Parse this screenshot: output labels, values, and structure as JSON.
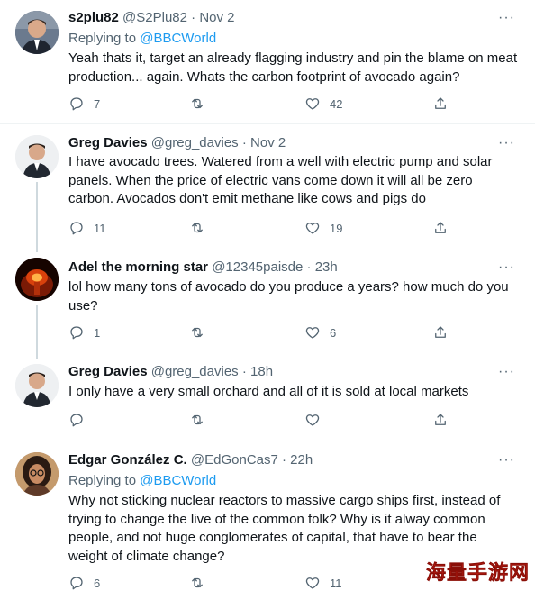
{
  "tweets": [
    {
      "name": "s2plu82",
      "handle": "@S2Plu82",
      "dot": "·",
      "time": "Nov 2",
      "replying_label": "Replying to ",
      "replying_to": "@BBCWorld",
      "text": "Yeah thats it, target an already flagging industry and pin the blame on meat production... again. Whats the carbon footprint of avocado again?",
      "replies": "7",
      "retweets": "",
      "likes": "42",
      "avatar_icon": "man-suit-avatar"
    },
    {
      "name": "Greg Davies",
      "handle": "@greg_davies",
      "dot": "·",
      "time": "Nov 2",
      "text": "I have avocado trees.  Watered from a well with electric pump and solar panels.  When the price of electric vans come down it will all be zero carbon.  Avocados don't emit methane like cows  and pigs do",
      "replies": "11",
      "retweets": "",
      "likes": "19",
      "avatar_icon": "man-portrait-avatar"
    },
    {
      "name": "Adel the morning star",
      "handle": "@12345paisde",
      "dot": "·",
      "time": "23h",
      "text": "lol  how many tons of avocado do you produce a years?  how  much do you use?",
      "replies": "1",
      "retweets": "",
      "likes": "6",
      "avatar_icon": "explosion-avatar"
    },
    {
      "name": "Greg Davies",
      "handle": "@greg_davies",
      "dot": "·",
      "time": "18h",
      "text": "I only have a very small orchard and all of it is sold at local markets",
      "replies": "",
      "retweets": "",
      "likes": "",
      "avatar_icon": "man-portrait-avatar"
    },
    {
      "name": "Edgar González C.",
      "handle": "@EdGonCas7",
      "dot": "·",
      "time": "22h",
      "replying_label": "Replying to ",
      "replying_to": "@BBCWorld",
      "text": "Why not sticking nuclear reactors to massive cargo ships first, instead of trying to change the live of the common folk? Why is it alway common people, and not huge conglomerates of capital, that have to bear the weight of climate change?",
      "replies": "6",
      "retweets": "",
      "likes": "11",
      "avatar_icon": "woman-glasses-avatar"
    }
  ],
  "more_icon": "···",
  "watermark": "海量手游网",
  "colors": {
    "text": "#0f1419",
    "secondary": "#536471",
    "link": "#1d9bf0",
    "thread_line": "#cfd9de",
    "divider": "#eff3f4"
  }
}
